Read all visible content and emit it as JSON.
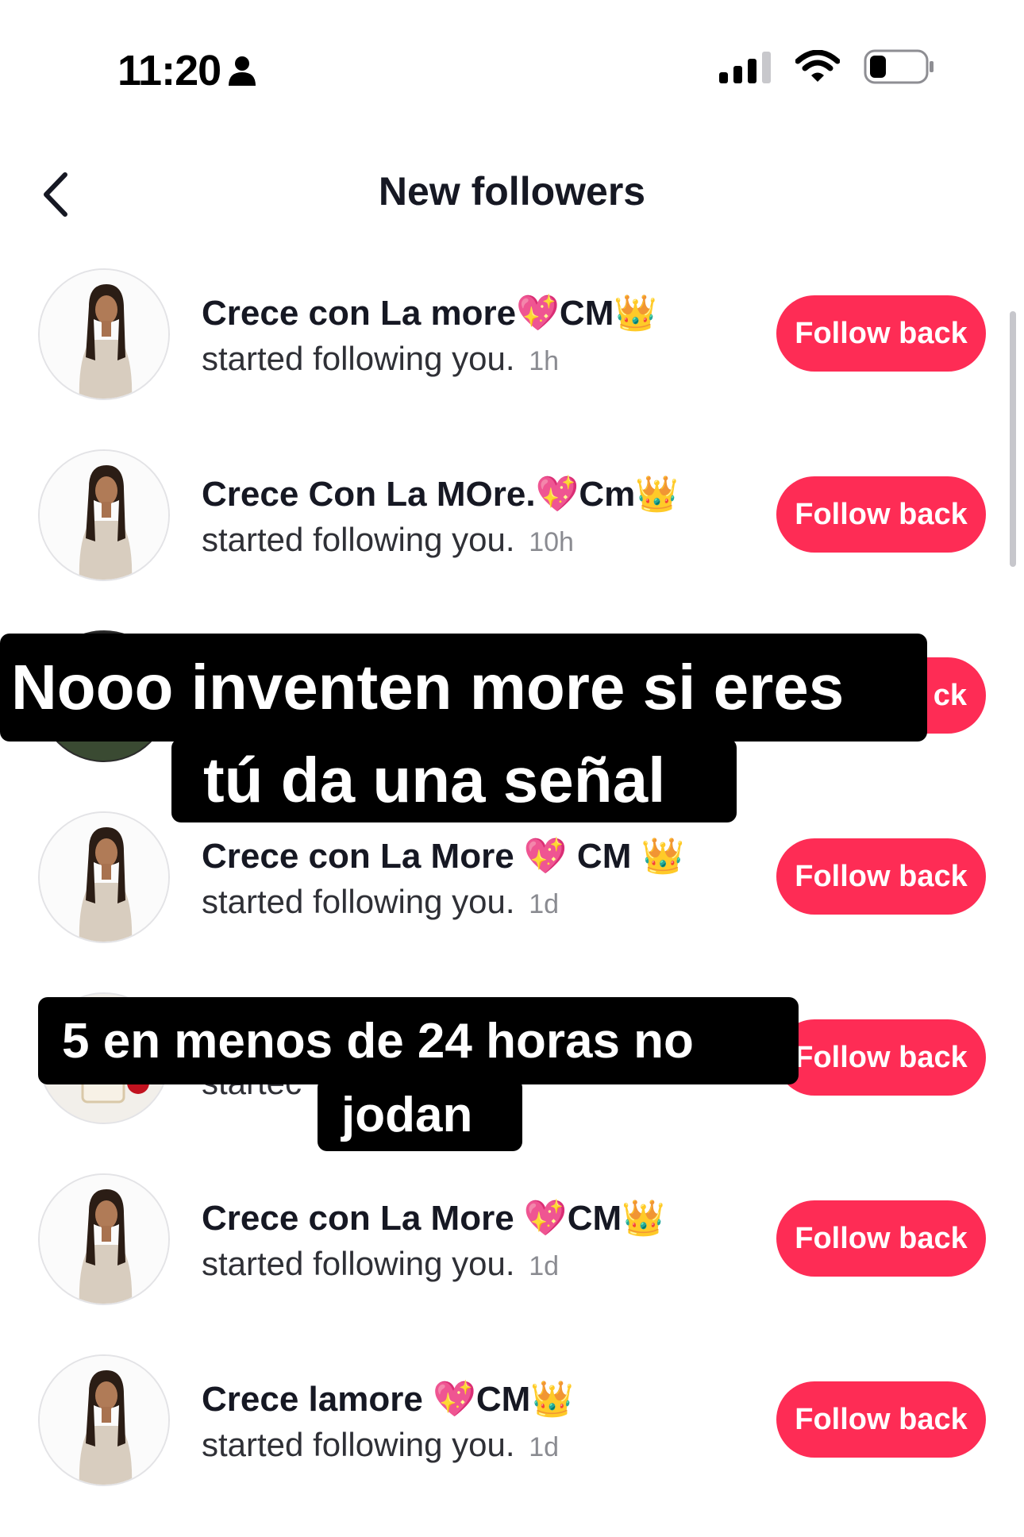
{
  "status_bar": {
    "time": "11:20"
  },
  "header": {
    "title": "New followers"
  },
  "followers": [
    {
      "name": "Crece con La more💖CM👑",
      "action": "started following you.",
      "time": "1h",
      "button": "Follow back"
    },
    {
      "name": "Crece Con La MOre.💖Cm👑",
      "action": "started following you.",
      "time": "10h",
      "button": "Follow back"
    },
    {
      "name": "",
      "action": "",
      "time": "",
      "button": "ck"
    },
    {
      "name": "Crece con La More 💖 CM 👑",
      "action": "started following you.",
      "time": "1d",
      "button": "Follow back"
    },
    {
      "name": "",
      "action": "startec",
      "time": "",
      "button": "Follow back"
    },
    {
      "name": "Crece con La More 💖CM👑",
      "action": "started following you.",
      "time": "1d",
      "button": "Follow back"
    },
    {
      "name": "Crece lamore 💖CM👑",
      "action": "started following you.",
      "time": "1d",
      "button": "Follow back"
    }
  ],
  "captions": {
    "line1a": "Nooo inventen more si eres",
    "line1b": "tú da una señal",
    "line2a": "5 en menos de 24 horas no",
    "line2b": "jodan"
  },
  "colors": {
    "accent": "#fe2c55",
    "text": "#161823",
    "muted": "#8a8b91",
    "caption_bg": "#000000"
  },
  "icons": [
    "person-icon",
    "signal-icon",
    "wifi-icon",
    "battery-icon",
    "back-chevron-icon",
    "profile-photo",
    "crown-emoji",
    "sparkling-heart-emoji"
  ]
}
